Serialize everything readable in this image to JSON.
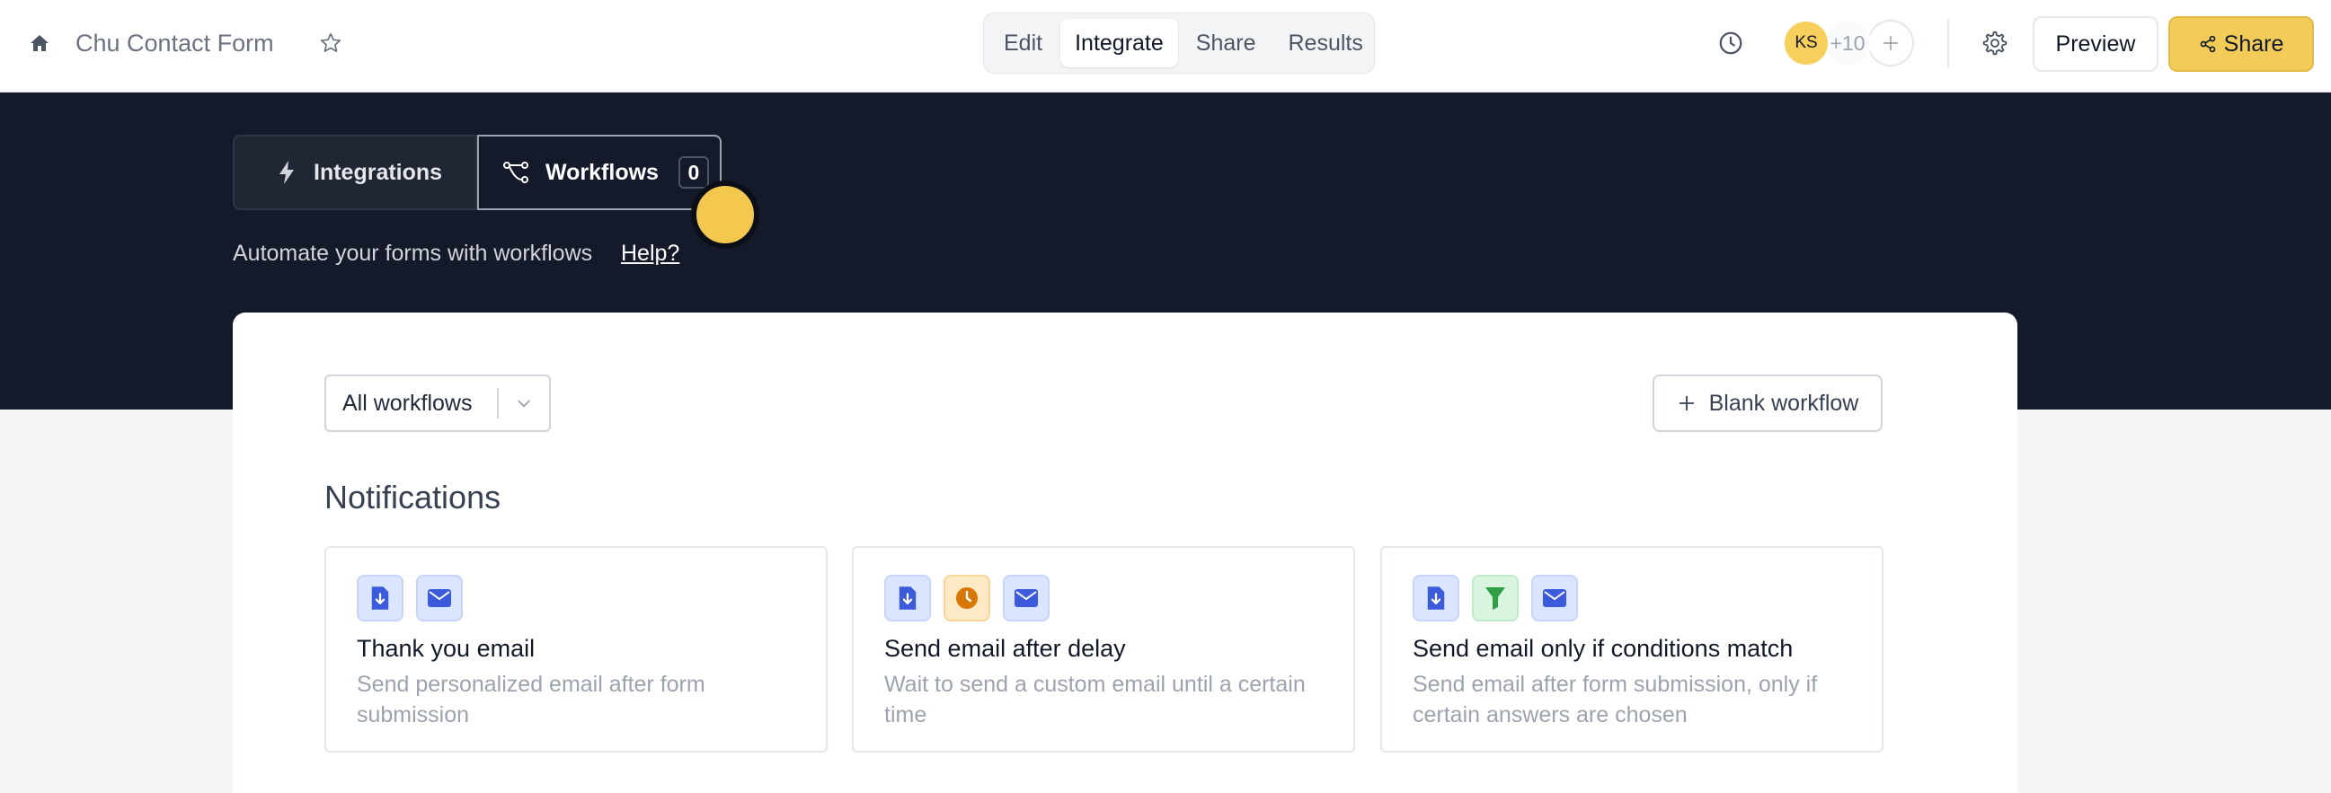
{
  "header": {
    "form_title": "Chu Contact Form",
    "mode_tabs": [
      "Edit",
      "Integrate",
      "Share",
      "Results"
    ],
    "active_tab": "Integrate",
    "avatar_initials": "KS",
    "collaborator_count": "+10",
    "preview_label": "Preview",
    "share_label": "Share"
  },
  "hero": {
    "segments": {
      "integrations_label": "Integrations",
      "workflows_label": "Workflows",
      "workflows_count": "0"
    },
    "description": "Automate your forms with workflows",
    "help_link": "Help?"
  },
  "workflows": {
    "filter_value": "All workflows",
    "blank_button": "Blank workflow",
    "section_title": "Notifications",
    "templates": [
      {
        "title": "Thank you email",
        "description": "Send personalized email after form submission",
        "icons": [
          "form-download-icon",
          "envelope-icon"
        ]
      },
      {
        "title": "Send email after delay",
        "description": "Wait to send a custom email until a certain time",
        "icons": [
          "form-download-icon",
          "clock-icon",
          "envelope-icon"
        ]
      },
      {
        "title": "Send email only if conditions match",
        "description": "Send email after form submission, only if certain answers are chosen",
        "icons": [
          "form-download-icon",
          "filter-icon",
          "envelope-icon"
        ]
      }
    ]
  },
  "colors": {
    "accent": "#f2cb58",
    "hero_bg": "#141a2a",
    "icon_blue": "#3b5bdb",
    "icon_orange": "#d97706",
    "icon_green": "#2f9e44"
  }
}
